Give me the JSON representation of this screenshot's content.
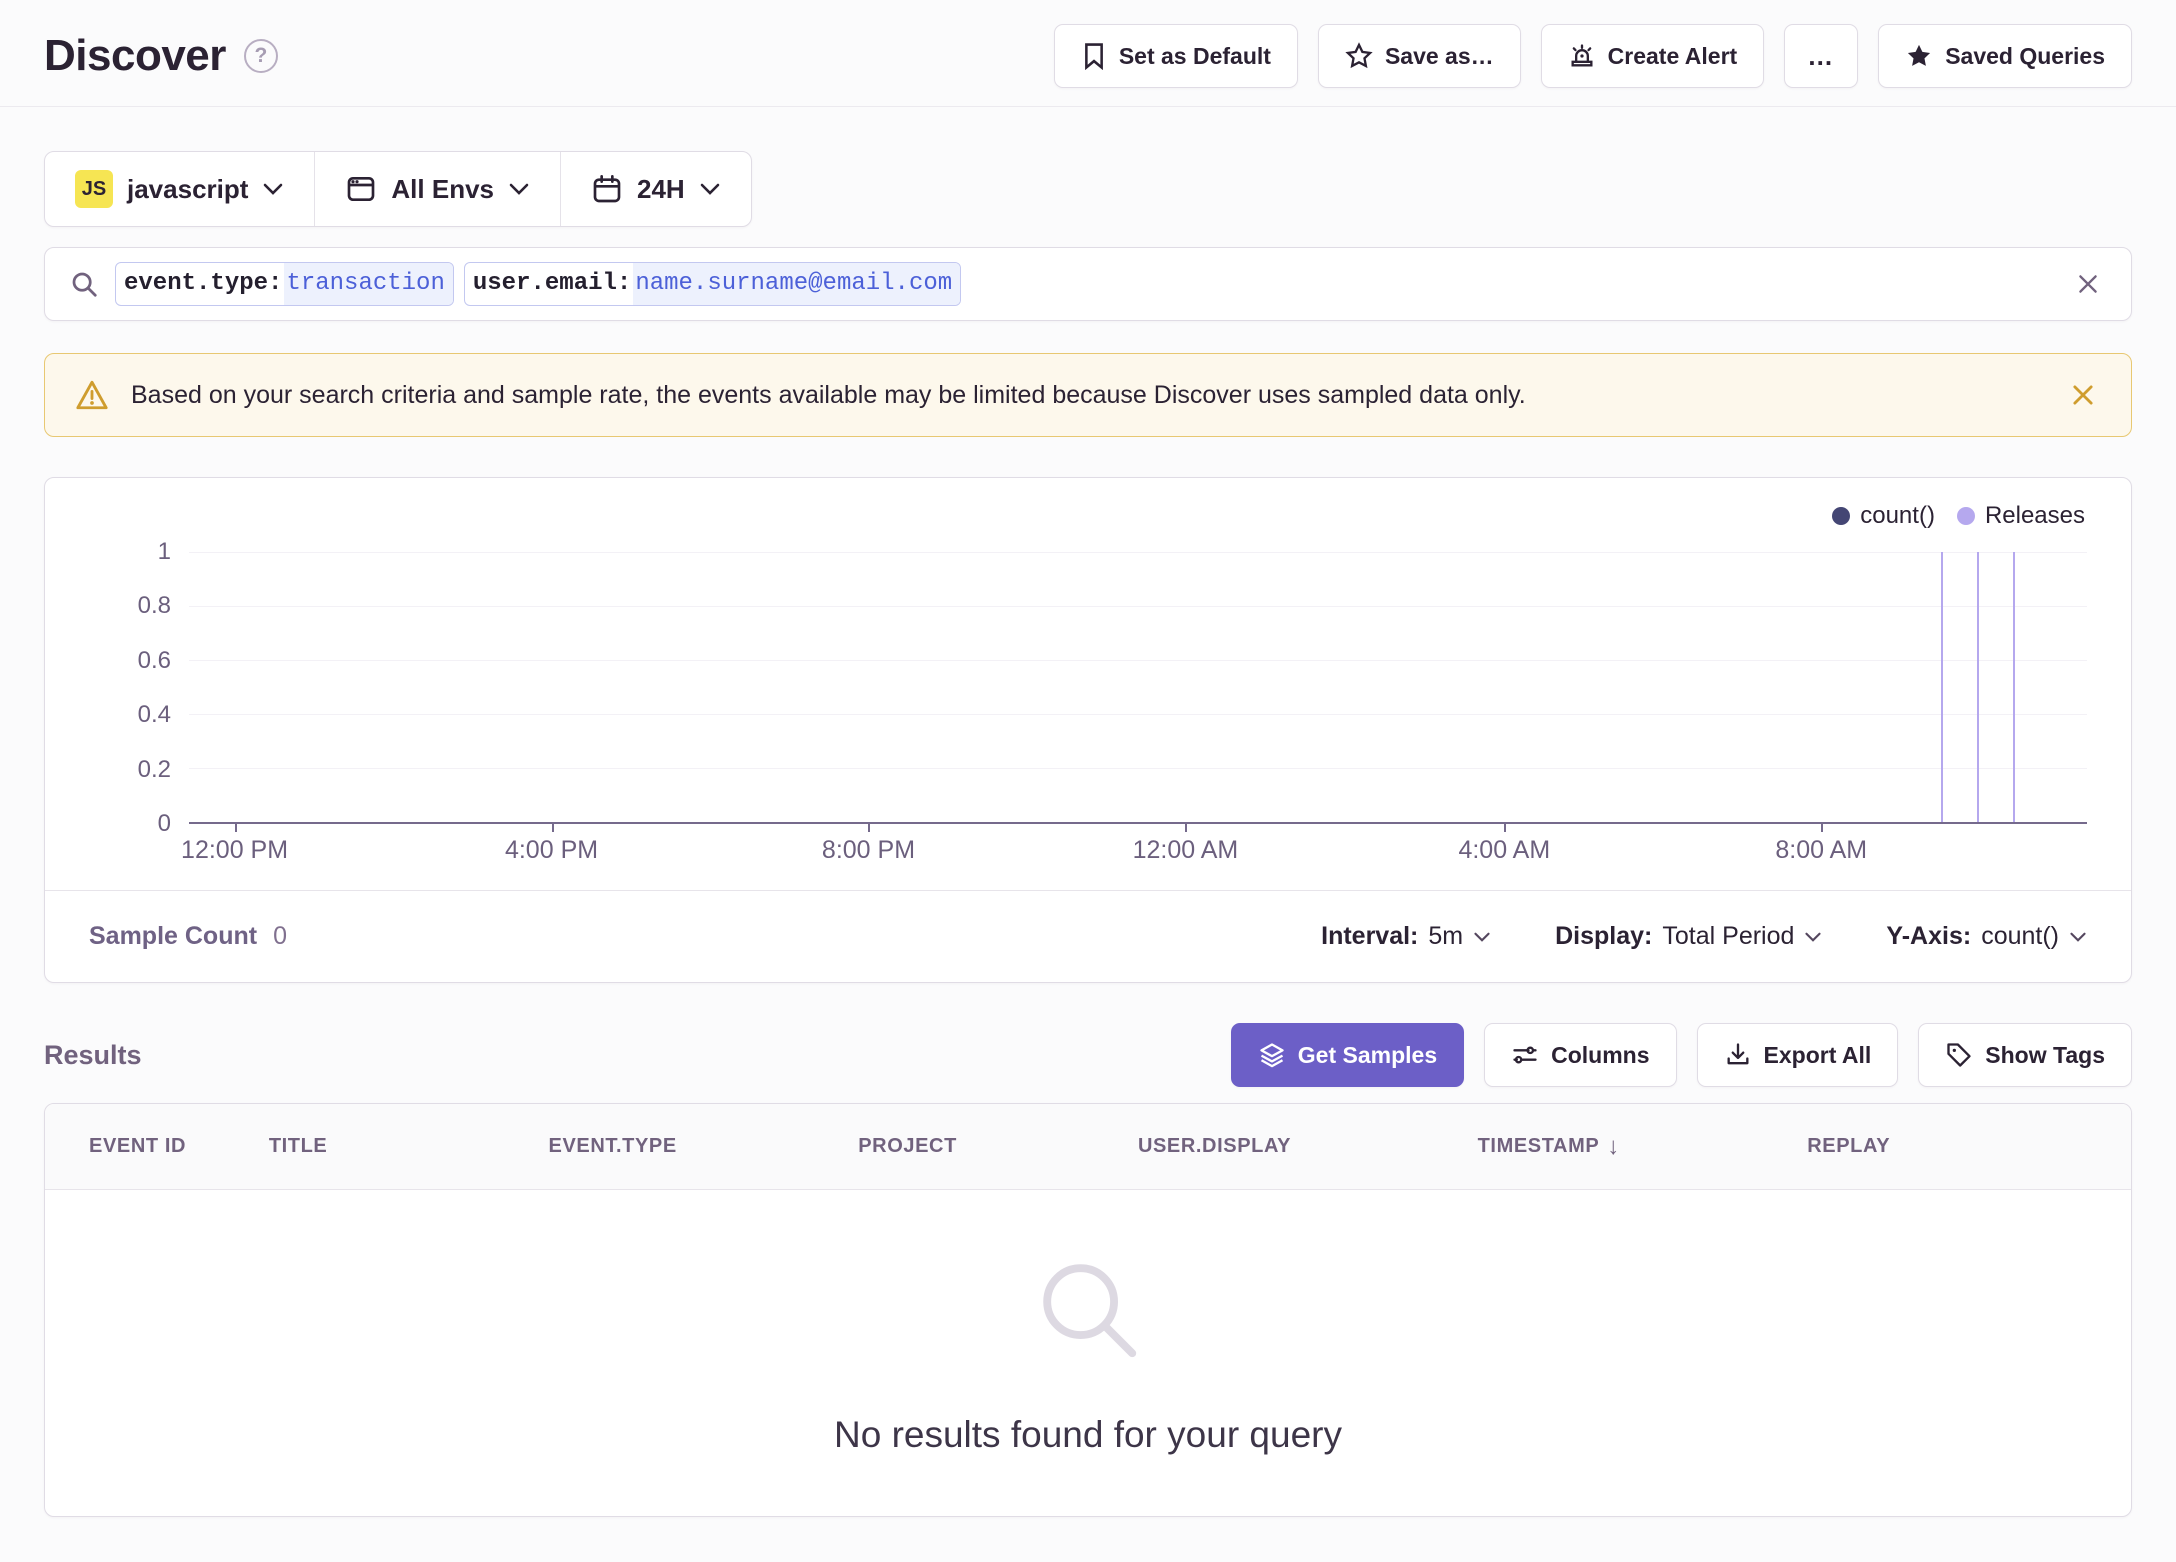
{
  "header": {
    "title": "Discover",
    "help_icon": "question-circle-icon",
    "buttons": [
      {
        "label": "Set as Default",
        "icon": "bookmark-icon"
      },
      {
        "label": "Save as…",
        "icon": "star-outline-icon"
      },
      {
        "label": "Create Alert",
        "icon": "siren-icon"
      },
      {
        "label": "…",
        "icon": "ellipsis-icon"
      },
      {
        "label": "Saved Queries",
        "icon": "star-filled-icon"
      }
    ]
  },
  "filters": {
    "project": {
      "badge": "JS",
      "label": "javascript"
    },
    "environment": {
      "label": "All Envs"
    },
    "time": {
      "label": "24H"
    }
  },
  "search": {
    "tokens": [
      {
        "key": "event.type:",
        "value": "transaction"
      },
      {
        "key": "user.email:",
        "value": "name.surname@email.com"
      }
    ]
  },
  "banner": {
    "text": "Based on your search criteria and sample rate, the events available may be limited because Discover uses sampled data only."
  },
  "chart": {
    "footer": {
      "sample_count_label": "Sample Count",
      "sample_count_value": "0",
      "interval_label": "Interval:",
      "interval_value": "5m",
      "display_label": "Display:",
      "display_value": "Total Period",
      "yaxis_label": "Y-Axis:",
      "yaxis_value": "count()"
    }
  },
  "chart_data": {
    "type": "line",
    "title": "",
    "xlabel": "",
    "ylabel": "",
    "ylim": [
      0,
      1
    ],
    "y_ticks": [
      0,
      0.2,
      0.4,
      0.6,
      0.8,
      1
    ],
    "x_ticks": [
      {
        "label": "12:00 PM",
        "pct": 2.4
      },
      {
        "label": "4:00 PM",
        "pct": 19.1
      },
      {
        "label": "8:00 PM",
        "pct": 35.8
      },
      {
        "label": "12:00 AM",
        "pct": 52.5
      },
      {
        "label": "4:00 AM",
        "pct": 69.3
      },
      {
        "label": "8:00 AM",
        "pct": 86.0
      }
    ],
    "series": [
      {
        "name": "count()",
        "color": "#444674",
        "values": []
      }
    ],
    "releases": {
      "name": "Releases",
      "color": "#b5a8ee",
      "positions_pct": [
        92.3,
        94.2,
        96.1
      ]
    },
    "legend_position": "top-right",
    "grid": true
  },
  "results": {
    "heading": "Results",
    "buttons": [
      {
        "label": "Get Samples",
        "icon": "layers-icon",
        "primary": true
      },
      {
        "label": "Columns",
        "icon": "sliders-icon"
      },
      {
        "label": "Export All",
        "icon": "download-icon"
      },
      {
        "label": "Show Tags",
        "icon": "tag-icon"
      }
    ],
    "table": {
      "headers": [
        {
          "label": "EVENT ID"
        },
        {
          "label": "TITLE"
        },
        {
          "label": "EVENT.TYPE"
        },
        {
          "label": "PROJECT"
        },
        {
          "label": "USER.DISPLAY"
        },
        {
          "label": "TIMESTAMP",
          "sorted": "desc"
        },
        {
          "label": "REPLAY"
        }
      ],
      "empty_text": "No results found for your query"
    }
  },
  "colors": {
    "accent": "#6c5fc7",
    "warning_bg": "#fdf8ec",
    "warning_border": "#e8c872",
    "warning_icon": "#cf9d2e",
    "token_value": "#4c60d8",
    "axis": "#756a8c"
  }
}
